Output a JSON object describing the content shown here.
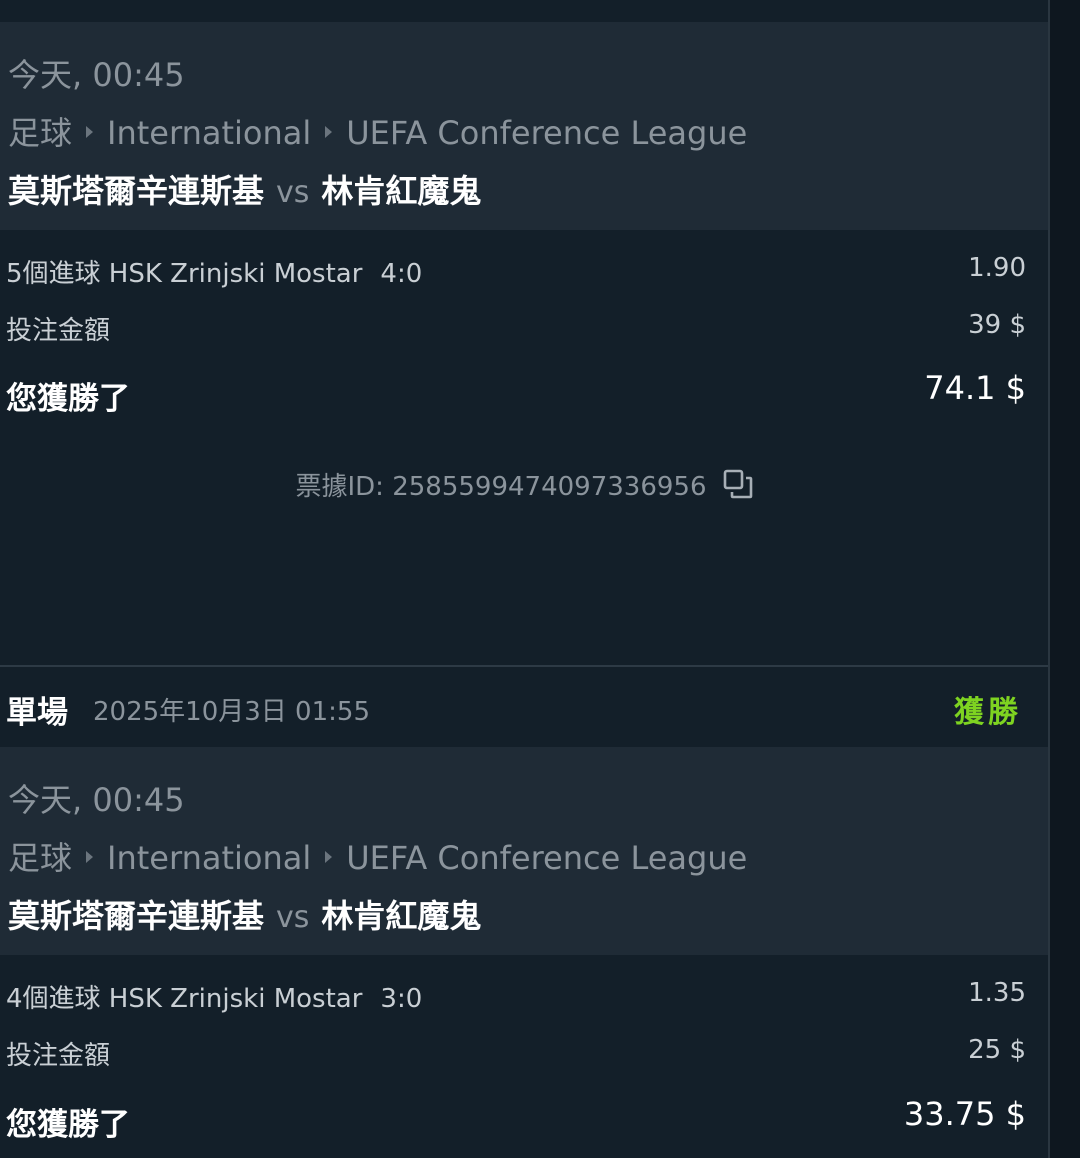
{
  "colors": {
    "background": "#131f29",
    "event_panel": "#1f2b36",
    "win_status": "#7ed321",
    "muted_text": "#8b949c"
  },
  "bets": [
    {
      "event": {
        "time": "今天, 00:45",
        "breadcrumb": [
          "足球",
          "International",
          "UEFA Conference League"
        ],
        "home_team": "莫斯塔爾辛連斯基",
        "vs": "vs",
        "away_team": "林肯紅魔鬼"
      },
      "selection": "5個進球 HSK Zrinjski Mostar",
      "selection_score": "4:0",
      "odds": "1.90",
      "stake_label": "投注金額",
      "stake": "39 $",
      "win_label": "您獲勝了",
      "win_amount": "74.1 $",
      "ticket_text": "票據ID: 2585599474097336956",
      "copy_icon": "copy-icon"
    },
    {
      "header": {
        "type": "單場",
        "date": "2025年10月3日 01:55",
        "status": "獲勝"
      },
      "event": {
        "time": "今天, 00:45",
        "breadcrumb": [
          "足球",
          "International",
          "UEFA Conference League"
        ],
        "home_team": "莫斯塔爾辛連斯基",
        "vs": "vs",
        "away_team": "林肯紅魔鬼"
      },
      "selection": "4個進球 HSK Zrinjski Mostar",
      "selection_score": "3:0",
      "odds": "1.35",
      "stake_label": "投注金額",
      "stake": "25 $",
      "win_label": "您獲勝了",
      "win_amount": "33.75 $"
    }
  ]
}
